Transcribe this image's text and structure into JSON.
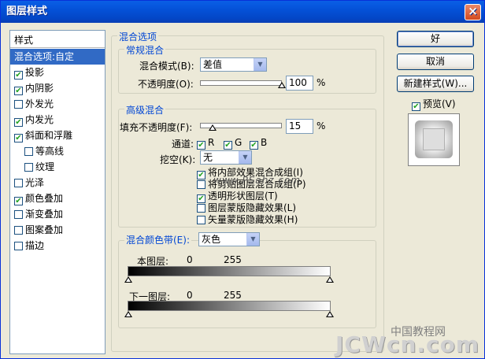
{
  "window": {
    "title": "图层样式",
    "close_glyph": "×"
  },
  "left_panel": {
    "header": "样式",
    "items": [
      {
        "label": "混合选项:自定",
        "selected": true,
        "checkbox": false
      },
      {
        "label": "投影",
        "checked": true
      },
      {
        "label": "内阴影",
        "checked": true
      },
      {
        "label": "外发光",
        "checked": false
      },
      {
        "label": "内发光",
        "checked": true
      },
      {
        "label": "斜面和浮雕",
        "checked": true
      },
      {
        "label": "等高线",
        "checked": false,
        "indent": true
      },
      {
        "label": "纹理",
        "checked": false,
        "indent": true
      },
      {
        "label": "光泽",
        "checked": false
      },
      {
        "label": "颜色叠加",
        "checked": true
      },
      {
        "label": "渐变叠加",
        "checked": false
      },
      {
        "label": "图案叠加",
        "checked": false
      },
      {
        "label": "描边",
        "checked": false
      }
    ]
  },
  "blend_options": {
    "title": "混合选项",
    "general": {
      "title": "常规混合",
      "blend_mode_label": "混合模式(B):",
      "blend_mode_value": "差值",
      "opacity_label": "不透明度(O):",
      "opacity_value": "100",
      "opacity_unit": "%",
      "opacity_level": 1.0
    },
    "advanced": {
      "title": "高级混合",
      "fill_label": "填充不透明度(F):",
      "fill_value": "15",
      "fill_unit": "%",
      "fill_level": 0.15,
      "channels_label": "通道:",
      "channel_r": "R",
      "channel_g": "G",
      "channel_b": "B",
      "knockout_label": "挖空(K):",
      "knockout_value": "无",
      "options": [
        {
          "label": "将内部效果混合成组(I)",
          "checked": true
        },
        {
          "label": "将剪贴图层混合成组(P)",
          "checked": false
        },
        {
          "label": "透明形状图层(T)",
          "checked": true
        },
        {
          "label": "图层蒙版隐藏效果(L)",
          "checked": false
        },
        {
          "label": "矢量蒙版隐藏效果(H)",
          "checked": false
        }
      ],
      "overlay_text": "www.PSahz.com"
    },
    "blend_if": {
      "label": "混合颜色带(E):",
      "value": "灰色",
      "this_layer_label": "本图层:",
      "this_layer_min": "0",
      "this_layer_max": "255",
      "under_layer_label": "下一图层:",
      "under_layer_min": "0",
      "under_layer_max": "255"
    }
  },
  "buttons": {
    "ok": "好",
    "cancel": "取消",
    "new_style": "新建样式(W)...",
    "preview_label": "预览(V)",
    "preview_checked": true
  },
  "watermark": {
    "top": "中国教程网",
    "bottom": "JCWcn.com"
  },
  "colors": {
    "title_bar": "#0450d6",
    "selection": "#316ac5",
    "group_label": "#0046d5",
    "dialog_bg": "#ece9d8"
  }
}
